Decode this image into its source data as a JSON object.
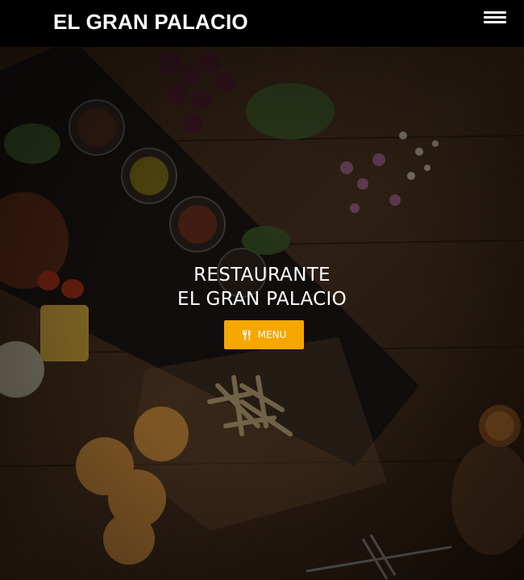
{
  "navbar": {
    "brand": "EL GRAN PALACIO",
    "menu_toggle_icon": "hamburger-icon"
  },
  "hero": {
    "title_line1": "RESTAURANTE",
    "title_line2": "EL GRAN PALACIO",
    "cta_label": "MENU",
    "cta_icon": "utensils-icon",
    "cta_color": "#f5a700"
  }
}
